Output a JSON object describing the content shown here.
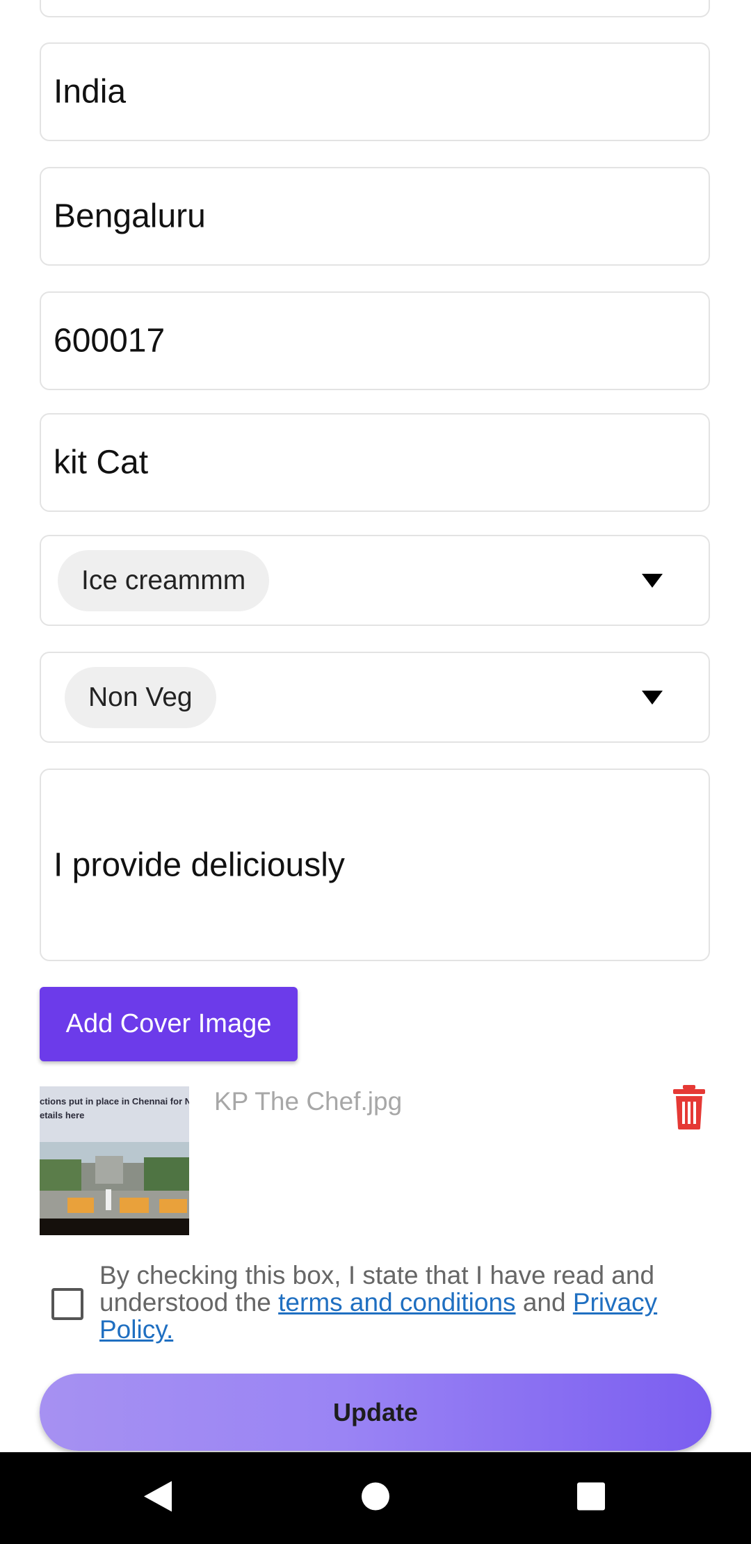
{
  "form": {
    "country": "India",
    "city": "Bengaluru",
    "pincode": "600017",
    "kitchen_name": "kit Cat",
    "cuisine_selected": "Ice creammm",
    "food_type_selected": "Non Veg",
    "description": "I provide deliciously"
  },
  "cover": {
    "button_label": "Add Cover Image",
    "file_name": "KP The Chef.jpg",
    "thumb_headline": "ctions put in place in Chennai for New",
    "thumb_sub": "etails here"
  },
  "agreement": {
    "prefix": "By checking this box, I state that I have read and understood the ",
    "terms_link": "terms and conditions",
    "middle": " and ",
    "privacy_link": "Privacy Policy.",
    "checked": false
  },
  "actions": {
    "update_label": "Update"
  },
  "colors": {
    "primary": "#6c3bea",
    "delete": "#e53935",
    "link": "#1f6fc1"
  },
  "icons": [
    "dropdown-caret-icon",
    "trash-icon",
    "back-icon",
    "home-icon",
    "recents-icon"
  ]
}
